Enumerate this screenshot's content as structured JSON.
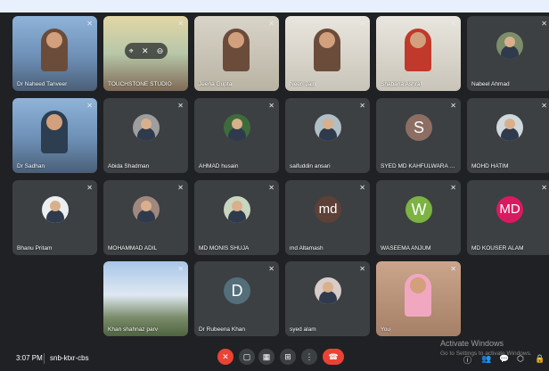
{
  "tiles": [
    {
      "name": "Dr Naheed Tanveer",
      "mic": "✕"
    },
    {
      "name": "TOUCHSTONE STUDIO",
      "mic": "✕"
    },
    {
      "name": "Jeena Gupta",
      "mic": "✕"
    },
    {
      "name": "Neeri Jain",
      "mic": "✕"
    },
    {
      "name": "Shabana Ashraf",
      "mic": "✕"
    },
    {
      "name": "Nabeel Ahmad",
      "mic": "✕"
    },
    {
      "name": "Dr Sadhan",
      "mic": "✕"
    },
    {
      "name": "Abida Shadman",
      "mic": "✕"
    },
    {
      "name": "AHMAD husain",
      "mic": "✕"
    },
    {
      "name": "saifuddin ansari",
      "mic": "✕"
    },
    {
      "name": "SYED MD KAHFULWARA A...",
      "mic": "✕",
      "initial": "S",
      "color": "#8d6e63"
    },
    {
      "name": "MOHD HATIM",
      "mic": "✕"
    },
    {
      "name": "Bhanu Pritam",
      "mic": "✕"
    },
    {
      "name": "MOHAMMAD ADIL",
      "mic": "✕"
    },
    {
      "name": "MD MONIS SHUJA",
      "mic": "✕"
    },
    {
      "name": "md Altamash",
      "mic": "✕",
      "initial": "md",
      "color": "#5d4037"
    },
    {
      "name": "WASEEMA ANJUM",
      "mic": "✕",
      "initial": "W",
      "color": "#7cb342"
    },
    {
      "name": "MD KOUSER ALAM",
      "mic": "✕",
      "initial": "MD",
      "color": "#d81b60"
    },
    {
      "name": "Khan shahnaz parv",
      "mic": "✕"
    },
    {
      "name": "Dr Rubeena Khan",
      "mic": "✕",
      "initial": "D",
      "color": "#546e7a"
    },
    {
      "name": "syed alam",
      "mic": "✕"
    },
    {
      "name": "You",
      "mic": "✕"
    }
  ],
  "bottom": {
    "time": "3:07 PM",
    "meeting_code": "snb-ktxr-cbs",
    "controls": [
      "✕",
      "▢",
      "▦",
      "⊞",
      "⋮",
      "☎"
    ],
    "right_icons": [
      "ⓘ",
      "👥",
      "💬",
      "⬡",
      "🔒"
    ]
  },
  "watermark": {
    "title": "Activate Windows",
    "subtitle": "Go to Settings to activate Windows."
  },
  "colors": {
    "bg": "#202124",
    "tile": "#3c4043",
    "end_call": "#ea4335"
  }
}
